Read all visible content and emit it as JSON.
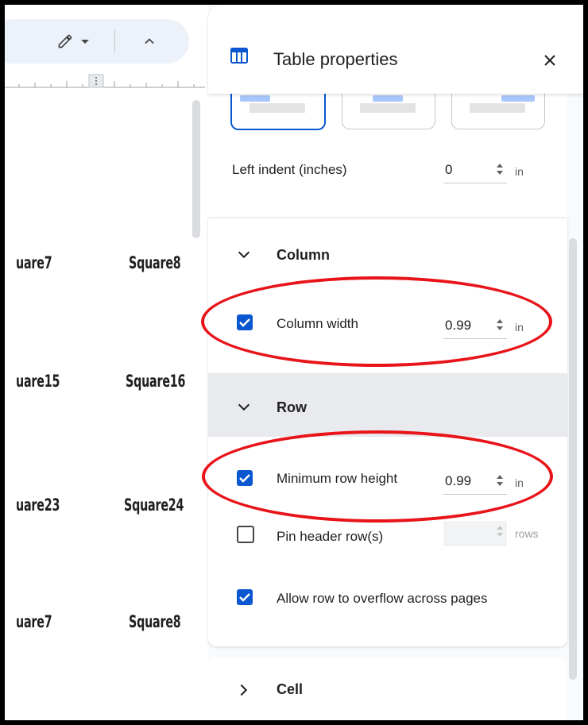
{
  "panel": {
    "title": "Table properties",
    "left_indent": {
      "label": "Left indent (inches)",
      "value": "0",
      "unit": "in"
    },
    "column": {
      "header": "Column",
      "column_width": {
        "label": "Column width",
        "checked": true,
        "value": "0.99",
        "unit": "in"
      }
    },
    "row": {
      "header": "Row",
      "min_row_height": {
        "label": "Minimum row height",
        "checked": true,
        "value": "0.99",
        "unit": "in"
      },
      "pin_header_rows": {
        "label": "Pin header row(s)",
        "checked": false,
        "value": "",
        "unit": "rows"
      },
      "allow_overflow": {
        "label": "Allow row to overflow across pages",
        "checked": true
      }
    },
    "cell": {
      "header": "Cell"
    }
  },
  "document": {
    "rows": [
      [
        "uare7",
        "Square8"
      ],
      [
        "uare15",
        "Square16"
      ],
      [
        "uare23",
        "Square24"
      ],
      [
        "uare7",
        "Square8"
      ]
    ]
  },
  "colors": {
    "accent": "#0b57d0",
    "highlight": "#e8141a",
    "panel_bg": "#f8fafd"
  },
  "icons": [
    "pencil-icon",
    "chevron-up-icon",
    "table-icon",
    "close-icon",
    "chevron-down-icon",
    "chevron-right-icon",
    "checkbox-icon",
    "spinner-icon"
  ]
}
